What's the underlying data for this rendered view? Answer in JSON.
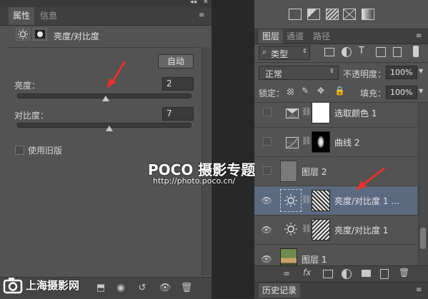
{
  "properties_panel": {
    "collapse_icon": "collapse-arrows-icon",
    "close_icon": "close-icon",
    "tabs": [
      {
        "label": "属性",
        "active": true
      },
      {
        "label": "信息",
        "active": false
      }
    ],
    "menu_icon": "panel-menu-icon",
    "adjustment_title": "亮度/对比度",
    "auto_button": "自动",
    "brightness_label": "亮度：",
    "brightness_value": "2",
    "contrast_label": "对比度：",
    "contrast_value": "7",
    "legacy_label": "使用旧版",
    "legacy_checked": false,
    "footer_icons": [
      "clip-to-layer-icon",
      "view-previous-state-icon",
      "reset-icon",
      "visibility-icon",
      "delete-icon"
    ]
  },
  "top_icons": [
    "brush-preset-icon",
    "gradient-icon",
    "pattern-icon",
    "mask-icon",
    "gradient-map-icon"
  ],
  "layers_panel": {
    "tabs": [
      {
        "label": "图层",
        "active": true
      },
      {
        "label": "通道",
        "active": false
      },
      {
        "label": "路径",
        "active": false
      }
    ],
    "filter_kind": "类型",
    "blend_mode": "正常",
    "opacity_label": "不透明度：",
    "opacity_value": "100%",
    "lock_label": "锁定：",
    "fill_label": "填充：",
    "fill_value": "100%",
    "layers": [
      {
        "name": "选取颜色 1",
        "visible": false,
        "type": "adjustment",
        "icon": "selective-color-icon",
        "mask": "white",
        "selected": false
      },
      {
        "name": "曲线 2",
        "visible": false,
        "type": "adjustment",
        "icon": "curves-icon",
        "mask": "black-with-blob",
        "selected": false
      },
      {
        "name": "图层 2",
        "visible": false,
        "type": "pixel",
        "icon": "",
        "mask": "",
        "selected": false
      },
      {
        "name": "亮度/对比度 1 ...",
        "visible": true,
        "type": "adjustment",
        "icon": "brightness-icon",
        "mask": "photo",
        "selected": true
      },
      {
        "name": "亮度/对比度 1",
        "visible": true,
        "type": "adjustment",
        "icon": "brightness-icon",
        "mask": "photo",
        "selected": false
      },
      {
        "name": "图层 1",
        "visible": true,
        "type": "pixel",
        "icon": "",
        "mask": "",
        "selected": false
      }
    ],
    "footer_icons": [
      "link-icon",
      "fx-icon",
      "mask-icon",
      "adjustment-icon",
      "group-icon",
      "new-layer-icon",
      "delete-icon"
    ]
  },
  "history_panel": {
    "label": "历史记录"
  },
  "watermarks": {
    "poco_logo": "POCO 摄影专题",
    "poco_url": "http://photo.poco.cn/",
    "shanghai_logo": "上海摄影网"
  },
  "colors": {
    "panel_bg": "#535353",
    "selected_row": "#5b6a80",
    "annotation_red": "#e8322e"
  }
}
